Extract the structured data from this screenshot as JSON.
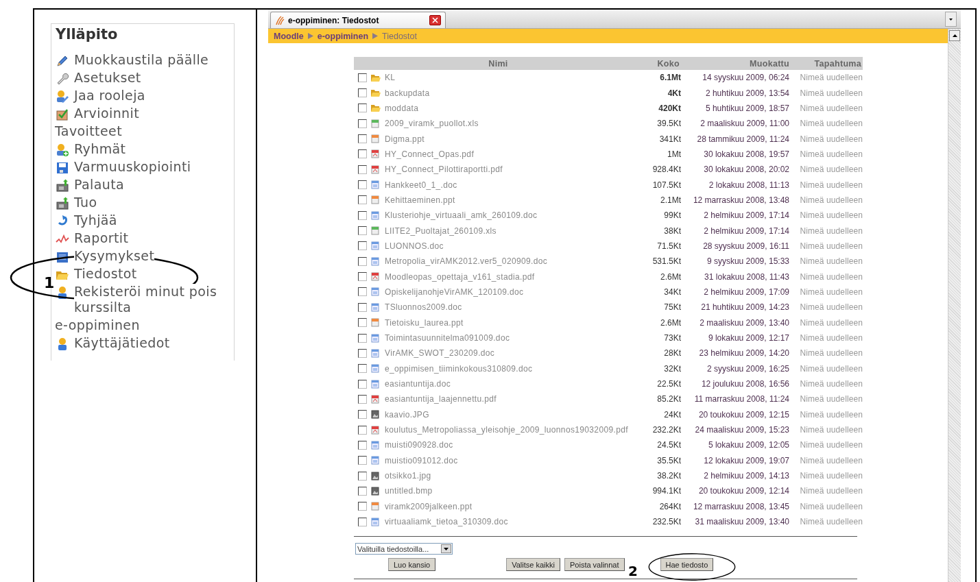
{
  "admin_block": {
    "title": "Ylläpito",
    "items": [
      {
        "label": "Muokkaustila päälle",
        "kind": "pencil"
      },
      {
        "label": "Asetukset",
        "kind": "wrench"
      },
      {
        "label": "Jaa rooleja",
        "kind": "roles"
      },
      {
        "label": "Arvioinnit",
        "kind": "grades"
      },
      {
        "label": "Tavoitteet",
        "kind": "none"
      },
      {
        "label": "Ryhmät",
        "kind": "groups"
      },
      {
        "label": "Varmuuskopiointi",
        "kind": "save"
      },
      {
        "label": "Palauta",
        "kind": "restore"
      },
      {
        "label": "Tuo",
        "kind": "restore"
      },
      {
        "label": "Tyhjää",
        "kind": "reset"
      },
      {
        "label": "Raportit",
        "kind": "reports"
      },
      {
        "label": "Kysymykset",
        "kind": "questions"
      },
      {
        "label": "Tiedostot",
        "kind": "folder"
      },
      {
        "label": "Rekisteröi minut pois kurssilta",
        "kind": "user"
      },
      {
        "label": "e-oppiminen",
        "kind": "none"
      },
      {
        "label": "Käyttäjätiedot",
        "kind": "user"
      }
    ]
  },
  "browser": {
    "tab_title": "e-oppiminen: Tiedostot",
    "breadcrumb": [
      {
        "label": "Moodle",
        "current": false
      },
      {
        "label": "e-oppiminen",
        "current": false
      },
      {
        "label": "Tiedostot",
        "current": true
      }
    ]
  },
  "file_table": {
    "columns": [
      "Nimi",
      "Koko",
      "Muokattu",
      "Tapahtuma"
    ],
    "rows": [
      {
        "name": "KL",
        "kind": "folder",
        "size": "6.1Mt",
        "modified": "14 syyskuu 2009, 06:24",
        "action": "Nimeä uudelleen",
        "checked": false
      },
      {
        "name": "backupdata",
        "kind": "folder",
        "size": "4Kt",
        "modified": "2 huhtikuu 2009, 13:54",
        "action": "Nimeä uudelleen",
        "checked": false
      },
      {
        "name": "moddata",
        "kind": "folder",
        "size": "420Kt",
        "modified": "5 huhtikuu 2009, 18:57",
        "action": "Nimeä uudelleen",
        "checked": false
      },
      {
        "name": "2009_viramk_puollot.xls",
        "kind": "xls",
        "size": "39.5Kt",
        "modified": "2 maaliskuu 2009, 11:00",
        "action": "Nimeä uudelleen",
        "checked": false
      },
      {
        "name": "Digma.ppt",
        "kind": "ppt",
        "size": "341Kt",
        "modified": "28 tammikuu 2009, 11:24",
        "action": "Nimeä uudelleen",
        "checked": false
      },
      {
        "name": "HY_Connect_Opas.pdf",
        "kind": "pdf",
        "size": "1Mt",
        "modified": "30 lokakuu 2008, 19:57",
        "action": "Nimeä uudelleen",
        "checked": false
      },
      {
        "name": "HY_Connect_Pilottiraportti.pdf",
        "kind": "pdf",
        "size": "928.4Kt",
        "modified": "30 lokakuu 2008, 20:02",
        "action": "Nimeä uudelleen",
        "checked": false
      },
      {
        "name": "Hankkeet0_1_.doc",
        "kind": "doc",
        "size": "107.5Kt",
        "modified": "2 lokakuu 2008, 11:13",
        "action": "Nimeä uudelleen",
        "checked": false
      },
      {
        "name": "Kehittaeminen.ppt",
        "kind": "ppt",
        "size": "2.1Mt",
        "modified": "12 marraskuu 2008, 13:48",
        "action": "Nimeä uudelleen",
        "checked": false
      },
      {
        "name": "Klusteriohje_virtuaali_amk_260109.doc",
        "kind": "doc",
        "size": "99Kt",
        "modified": "2 helmikuu 2009, 17:14",
        "action": "Nimeä uudelleen",
        "checked": false
      },
      {
        "name": "LIITE2_Puoltajat_260109.xls",
        "kind": "xls",
        "size": "38Kt",
        "modified": "2 helmikuu 2009, 17:14",
        "action": "Nimeä uudelleen",
        "checked": false
      },
      {
        "name": "LUONNOS.doc",
        "kind": "doc",
        "size": "71.5Kt",
        "modified": "28 syyskuu 2009, 16:11",
        "action": "Nimeä uudelleen",
        "checked": false
      },
      {
        "name": "Metropolia_virAMK2012.ver5_020909.doc",
        "kind": "doc",
        "size": "531.5Kt",
        "modified": "9 syyskuu 2009, 15:33",
        "action": "Nimeä uudelleen",
        "checked": false
      },
      {
        "name": "Moodleopas_opettaja_v161_stadia.pdf",
        "kind": "pdf",
        "size": "2.6Mt",
        "modified": "31 lokakuu 2008, 11:43",
        "action": "Nimeä uudelleen",
        "checked": false
      },
      {
        "name": "OpiskelijanohjeVirAMK_120109.doc",
        "kind": "doc",
        "size": "34Kt",
        "modified": "2 helmikuu 2009, 17:09",
        "action": "Nimeä uudelleen",
        "checked": false
      },
      {
        "name": "TSluonnos2009.doc",
        "kind": "doc",
        "size": "75Kt",
        "modified": "21 huhtikuu 2009, 14:23",
        "action": "Nimeä uudelleen",
        "checked": false
      },
      {
        "name": "Tietoisku_laurea.ppt",
        "kind": "ppt",
        "size": "2.6Mt",
        "modified": "2 maaliskuu 2009, 13:40",
        "action": "Nimeä uudelleen",
        "checked": false
      },
      {
        "name": "Toimintasuunnitelma091009.doc",
        "kind": "doc",
        "size": "73Kt",
        "modified": "9 lokakuu 2009, 12:17",
        "action": "Nimeä uudelleen",
        "checked": false
      },
      {
        "name": "VirAMK_SWOT_230209.doc",
        "kind": "doc",
        "size": "28Kt",
        "modified": "23 helmikuu 2009, 14:20",
        "action": "Nimeä uudelleen",
        "checked": false
      },
      {
        "name": "e_oppimisen_tiiminkokous310809.doc",
        "kind": "doc",
        "size": "32Kt",
        "modified": "2 syyskuu 2009, 16:25",
        "action": "Nimeä uudelleen",
        "checked": false
      },
      {
        "name": "easiantuntija.doc",
        "kind": "doc",
        "size": "22.5Kt",
        "modified": "12 joulukuu 2008, 16:56",
        "action": "Nimeä uudelleen",
        "checked": false
      },
      {
        "name": "easiantuntija_laajennettu.pdf",
        "kind": "pdf",
        "size": "85.2Kt",
        "modified": "11 marraskuu 2008, 11:24",
        "action": "Nimeä uudelleen",
        "checked": false
      },
      {
        "name": "kaavio.JPG",
        "kind": "image",
        "size": "24Kt",
        "modified": "20 toukokuu 2009, 12:15",
        "action": "Nimeä uudelleen",
        "checked": false
      },
      {
        "name": "koulutus_Metropoliassa_yleisohje_2009_luonnos19032009.pdf",
        "kind": "pdf",
        "size": "232.2Kt",
        "modified": "24 maaliskuu 2009, 15:23",
        "action": "Nimeä uudelleen",
        "checked": false
      },
      {
        "name": "muisti090928.doc",
        "kind": "doc",
        "size": "24.5Kt",
        "modified": "5 lokakuu 2009, 12:05",
        "action": "Nimeä uudelleen",
        "checked": false
      },
      {
        "name": "muistio091012.doc",
        "kind": "doc",
        "size": "35.5Kt",
        "modified": "12 lokakuu 2009, 19:07",
        "action": "Nimeä uudelleen",
        "checked": false
      },
      {
        "name": "otsikko1.jpg",
        "kind": "image",
        "size": "38.2Kt",
        "modified": "2 helmikuu 2009, 14:13",
        "action": "Nimeä uudelleen",
        "checked": false
      },
      {
        "name": "untitled.bmp",
        "kind": "image",
        "size": "994.1Kt",
        "modified": "20 toukokuu 2009, 12:14",
        "action": "Nimeä uudelleen",
        "checked": false
      },
      {
        "name": "viramk2009jalkeen.ppt",
        "kind": "ppt",
        "size": "264Kt",
        "modified": "12 marraskuu 2008, 13:45",
        "action": "Nimeä uudelleen",
        "checked": false
      },
      {
        "name": "virtuaaliamk_tietoa_310309.doc",
        "kind": "doc",
        "size": "232.5Kt",
        "modified": "31 maaliskuu 2009, 13:40",
        "action": "Nimeä uudelleen",
        "checked": false
      }
    ]
  },
  "actions": {
    "select": "Valituilla tiedostoilla...",
    "create_folder": "Luo kansio",
    "buttons": [
      "Valitse kaikki",
      "Poista valinnat",
      "Hae tiedosto"
    ]
  },
  "annotations": [
    "1",
    "2"
  ]
}
